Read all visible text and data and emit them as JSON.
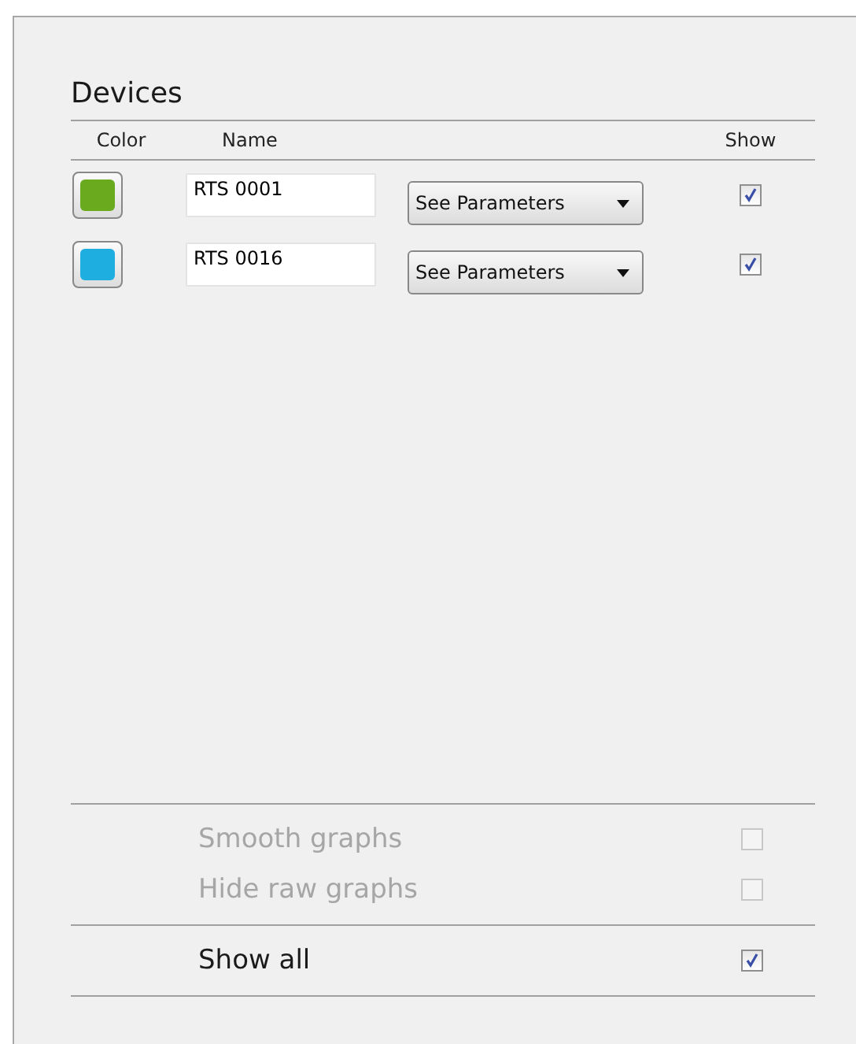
{
  "panel": {
    "title": "Devices"
  },
  "columns": [
    "Color",
    "Name",
    "Show"
  ],
  "devices": [
    {
      "color": "#6aaa1e",
      "name": "RTS 0001",
      "menu": "See Parameters",
      "show": true
    },
    {
      "color": "#1eaee0",
      "name": "RTS 0016",
      "menu": "See Parameters",
      "show": true
    }
  ],
  "options": [
    {
      "label": "Smooth graphs",
      "checked": false,
      "disabled": true
    },
    {
      "label": "Hide raw graphs",
      "checked": false,
      "disabled": true
    }
  ],
  "show_all": {
    "label": "Show all",
    "checked": true,
    "disabled": false
  }
}
